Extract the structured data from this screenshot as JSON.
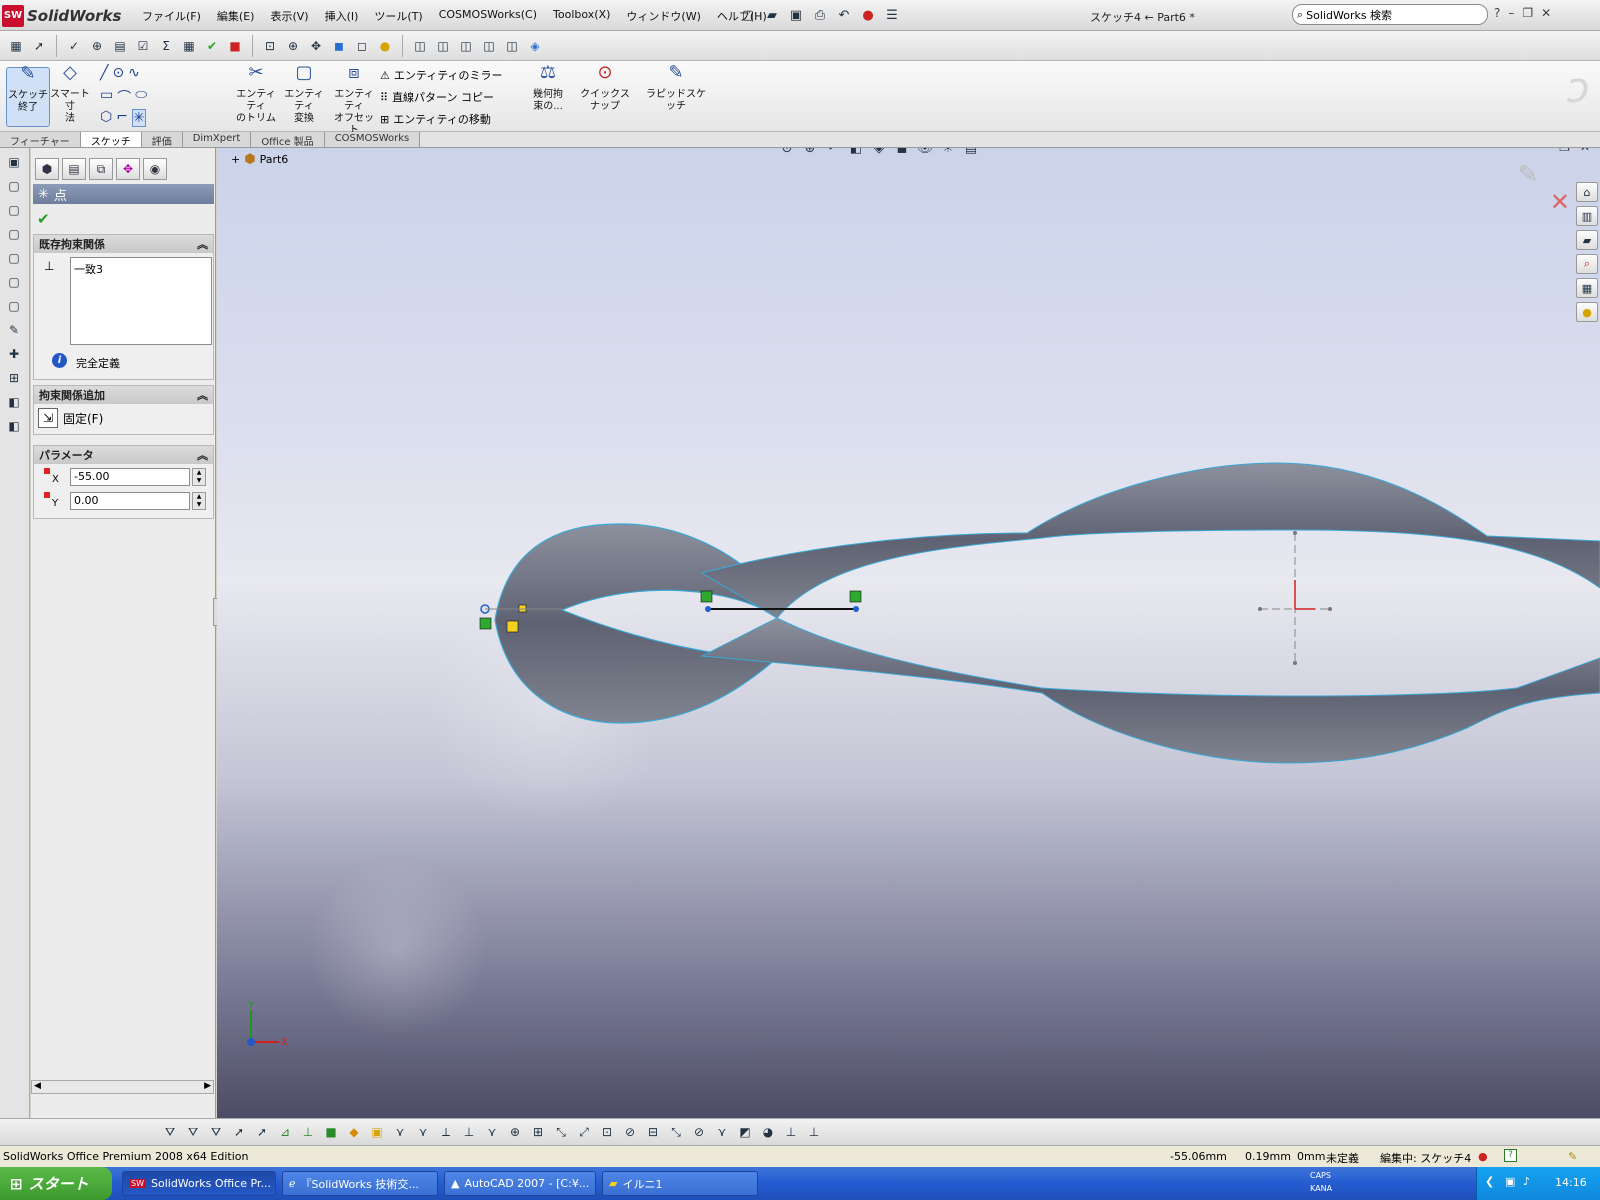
{
  "titlebar": {
    "app_name": "SolidWorks",
    "menu": [
      "ファイル(F)",
      "編集(E)",
      "表示(V)",
      "挿入(I)",
      "ツール(T)",
      "COSMOSWorks(C)",
      "Toolbox(X)",
      "ウィンドウ(W)",
      "ヘルプ(H)"
    ],
    "doc_title": "スケッチ4 ← Part6 *",
    "search_placeholder": "SolidWorks 検索",
    "help_label": "?"
  },
  "command_manager": {
    "sketch_exit": "スケッチ\n終了",
    "smart_dim": "スマート寸\n法",
    "trim": "エンティティ\nのトリム",
    "convert": "エンティティ\n変換",
    "offset": "エンティティ\nオフセット",
    "mirror": "エンティティのミラー",
    "linear_pattern": "直線パターン コピー",
    "move": "エンティティの移動",
    "relations": "幾何拘\n束の...",
    "quick_snaps": "クイックスナップ",
    "rapid_sketch": "ラピッドスケッチ"
  },
  "tabs": [
    "フィーチャー",
    "スケッチ",
    "評価",
    "DimXpert",
    "Office 製品",
    "COSMOSWorks"
  ],
  "active_tab": "スケッチ",
  "property_manager": {
    "title": "点",
    "existing_relations_header": "既存拘束関係",
    "relations": [
      "一致3"
    ],
    "fully_defined": "完全定義",
    "add_relations_header": "拘束関係追加",
    "fix_label": "固定(F)",
    "params_header": "パラメータ",
    "x_label": "X",
    "y_label": "Y",
    "x_value": "-55.00",
    "y_value": "0.00"
  },
  "viewport": {
    "tree_root": "Part6",
    "axis_x": "X",
    "axis_y": "Y"
  },
  "status_bar": {
    "edition": "SolidWorks Office Premium 2008 x64 Edition",
    "x_coord": "-55.06mm",
    "y_coord": "0.19mm",
    "z_coord": "0mm",
    "definition": "未定義",
    "editing": "編集中: スケッチ4"
  },
  "taskbar": {
    "start": "スタート",
    "tasks": [
      "SolidWorks Office Pr...",
      "『SolidWorks 技術交...",
      "AutoCAD 2007 - [C:¥...",
      "イルニ1"
    ],
    "caps": "CAPS",
    "kana": "KANA",
    "clock": "14:16"
  },
  "colors": {
    "accent": "#2a4f9c",
    "sketch_blue": "#1e5fd6",
    "surface": "#6f7382",
    "surface_edge": "#39a8d8",
    "origin_red": "#d22020"
  }
}
